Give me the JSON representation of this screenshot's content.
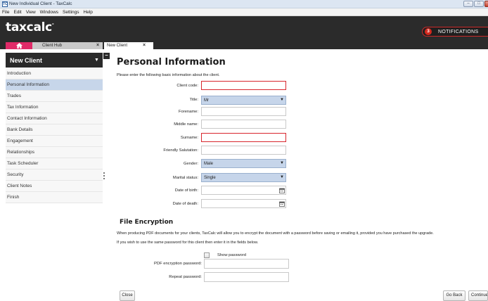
{
  "window": {
    "app_icon": "TC",
    "title": "New Individual Client - TaxCalc",
    "controls": {
      "minimize": "–",
      "maximize": "□",
      "close": "×"
    }
  },
  "menu": [
    "File",
    "Edit",
    "View",
    "Windows",
    "Settings",
    "Help"
  ],
  "brand": {
    "logo": "taxcalc",
    "logo_mark": "°"
  },
  "notifications": {
    "count": "3",
    "label": "NOTIFICATIONS"
  },
  "tabs": [
    {
      "label": "Client Hub",
      "close": "×"
    },
    {
      "label": "New Client",
      "close": "×"
    }
  ],
  "sidebar": {
    "title": "New Client",
    "caret": "▼",
    "collapse": "–",
    "items": [
      "Introduction",
      "Personal Information",
      "Trades",
      "Tax Information",
      "Contact Information",
      "Bank Details",
      "Engagement",
      "Relationships",
      "Task Scheduler",
      "Security",
      "Client Notes",
      "Finish"
    ],
    "active_index": 1
  },
  "form": {
    "heading": "Personal Information",
    "intro": "Please enter the following basic information about the client.",
    "client_code": {
      "label": "Client code:",
      "value": ""
    },
    "title": {
      "label": "Title:",
      "value": "Mr"
    },
    "forename": {
      "label": "Forename:",
      "value": ""
    },
    "middle_name": {
      "label": "Middle name:",
      "value": ""
    },
    "surname": {
      "label": "Surname:",
      "value": ""
    },
    "friendly_salutation": {
      "label": "Friendly Salutation:",
      "value": ""
    },
    "gender": {
      "label": "Gender:",
      "value": "Male"
    },
    "marital_status": {
      "label": "Marital status:",
      "value": "Single"
    },
    "date_of_birth": {
      "label": "Date of birth:",
      "value": ""
    },
    "date_of_death": {
      "label": "Date of death:",
      "value": ""
    },
    "arrow": "▼"
  },
  "encryption": {
    "heading": "File Encryption",
    "para1": "When producing PDF documents for your clients, TaxCalc will allow you to encrypt the document with a password before saving or emailing it, provided you have purchased the upgrade.",
    "para2": "If you wish to use the same password for this client then enter it in the fields below.",
    "show_password": "Show password",
    "pdf_password_label": "PDF encryption password:",
    "repeat_password_label": "Repeat password:"
  },
  "buttons": {
    "close": "Close",
    "go_back": "Go Back",
    "continue": "Continue"
  },
  "colors": {
    "accent_pink": "#e02a68",
    "required_red": "#d8262d",
    "active_item": "#c7d6ea",
    "header_dark": "#2b2b2b"
  },
  "icons": {
    "home": "home-icon",
    "calendar": "calendar-icon"
  }
}
